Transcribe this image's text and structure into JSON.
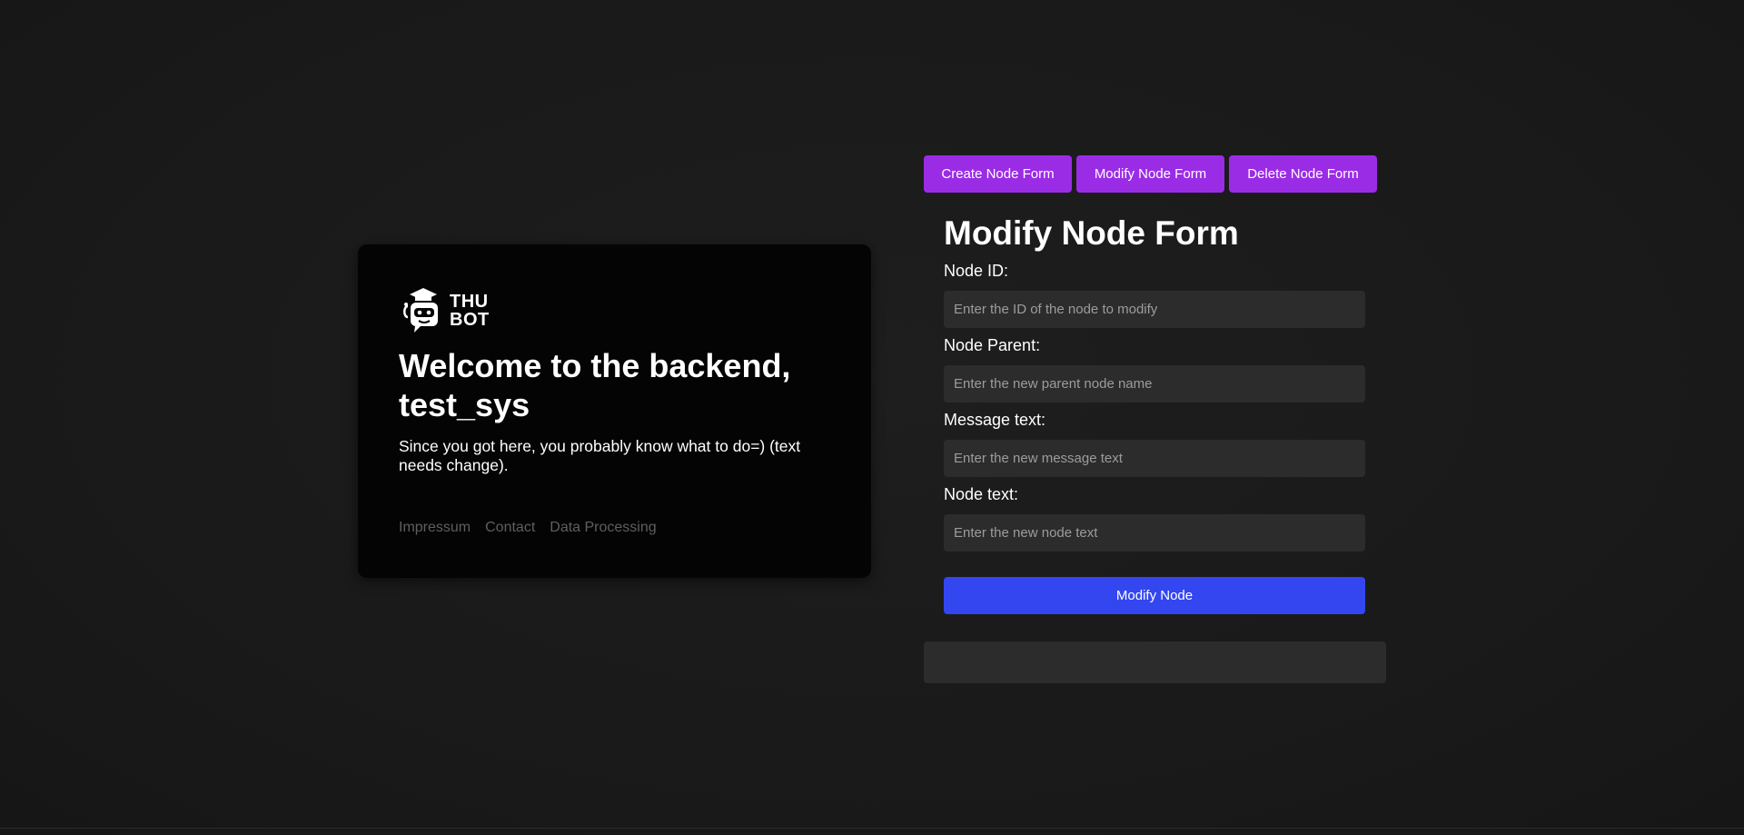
{
  "logo": {
    "line1": "THU",
    "line2": "BOT"
  },
  "welcome": {
    "title": "Welcome to the backend, test_sys",
    "text": "Since you got here, you probably know what to do=) (text needs change)."
  },
  "footer": {
    "links": [
      "Impressum",
      "Contact",
      "Data Processing"
    ]
  },
  "tabs": [
    {
      "label": "Create Node Form"
    },
    {
      "label": "Modify Node Form"
    },
    {
      "label": "Delete Node Form"
    }
  ],
  "form": {
    "title": "Modify Node Form",
    "fields": [
      {
        "label": "Node ID:",
        "placeholder": "Enter the ID of the node to modify",
        "value": ""
      },
      {
        "label": "Node Parent:",
        "placeholder": "Enter the new parent node name",
        "value": ""
      },
      {
        "label": "Message text:",
        "placeholder": "Enter the new message text",
        "value": ""
      },
      {
        "label": "Node text:",
        "placeholder": "Enter the new node text",
        "value": ""
      }
    ],
    "submit_label": "Modify Node"
  },
  "result": {
    "text": ""
  },
  "colors": {
    "tab_accent": "#9b2ce6",
    "submit_accent": "#3346f0",
    "background": "#1b1b1b",
    "card_background": "#040404",
    "input_background": "#2c2c2c"
  }
}
